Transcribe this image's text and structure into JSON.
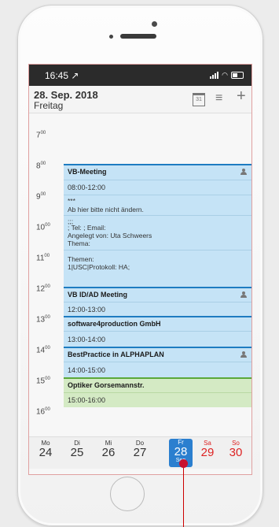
{
  "status": {
    "time": "16:45 ↗"
  },
  "header": {
    "date": "28. Sep. 2018",
    "weekday": "Freitag",
    "calendar_icon_text": "31"
  },
  "timeline": {
    "hours": [
      "7",
      "8",
      "9",
      "10",
      "11",
      "12",
      "13",
      "14",
      "15",
      "16"
    ],
    "minutes": "00"
  },
  "events": [
    {
      "title": "VB-Meeting",
      "time": "08:00-12:00",
      "has_attendee": true,
      "description": [
        "***",
        "Ab hier bitte nicht ändern.",
        ";;;",
        "; Tel: ; Email:",
        "Angelegt von: Uta Schweers",
        "Thema:",
        "Themen:",
        "1|USC|Protokoll: HA;"
      ]
    },
    {
      "title": "VB ID/AD Meeting",
      "time": "12:00-13:00",
      "has_attendee": true
    },
    {
      "title": "software4production GmbH",
      "time": "13:00-14:00",
      "has_attendee": false
    },
    {
      "title": "BestPractice in ALPHAPLAN",
      "time": "14:00-15:00",
      "has_attendee": true
    },
    {
      "title": "Optiker Gorsemannstr.",
      "time": "15:00-16:00",
      "has_attendee": false
    }
  ],
  "daybar": {
    "days": [
      {
        "name": "Mo",
        "num": "24"
      },
      {
        "name": "Di",
        "num": "25"
      },
      {
        "name": "Mi",
        "num": "26"
      },
      {
        "name": "Do",
        "num": "27"
      },
      {
        "name": "Fr",
        "num": "28",
        "month": "Sep"
      },
      {
        "name": "Sa",
        "num": "29"
      },
      {
        "name": "So",
        "num": "30"
      }
    ]
  },
  "colors": {
    "accent": "#2b7fcf",
    "event_blue": "#c5e3f6",
    "event_green": "#d4eac4",
    "weekend": "#d22222"
  }
}
